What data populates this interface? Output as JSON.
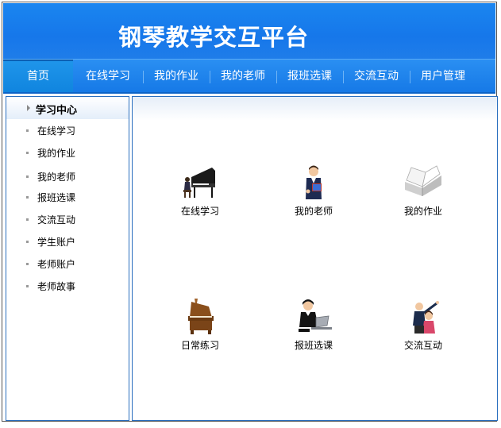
{
  "app": {
    "title": "钢琴教学交互平台"
  },
  "nav": {
    "tabs": [
      {
        "label": "首页",
        "active": true
      },
      {
        "label": "在线学习"
      },
      {
        "label": "我的作业"
      },
      {
        "label": "我的老师"
      },
      {
        "label": "报班选课"
      },
      {
        "label": "交流互动"
      },
      {
        "label": "用户管理"
      }
    ]
  },
  "sidebar": {
    "header": "学习中心",
    "items": [
      {
        "label": "在线学习"
      },
      {
        "label": "我的作业"
      },
      {
        "label": "我的老师"
      },
      {
        "label": "报班选课"
      },
      {
        "label": "交流互动"
      },
      {
        "label": "学生账户"
      },
      {
        "label": "老师账户"
      },
      {
        "label": "老师故事"
      }
    ]
  },
  "tiles": [
    {
      "label": "在线学习",
      "icon": "grand-piano-player-icon"
    },
    {
      "label": "我的老师",
      "icon": "teacher-icon"
    },
    {
      "label": "我的作业",
      "icon": "open-book-icon"
    },
    {
      "label": "日常练习",
      "icon": "upright-piano-icon"
    },
    {
      "label": "报班选课",
      "icon": "laptop-user-icon"
    },
    {
      "label": "交流互动",
      "icon": "people-interaction-icon"
    }
  ],
  "colors": {
    "accent": "#1677ea",
    "border": "#2a6fbf"
  }
}
